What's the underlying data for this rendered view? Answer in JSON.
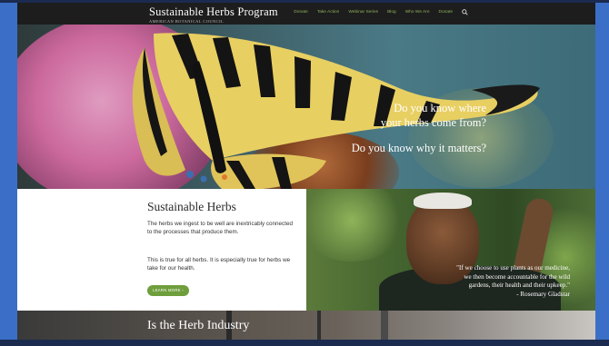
{
  "header": {
    "title": "Sustainable Herbs Program",
    "subtitle": "AMERICAN BOTANICAL COUNCIL",
    "nav": [
      "Donate",
      "Take Action",
      "Webinar Series",
      "Blog",
      "Who We Are",
      "Donate"
    ],
    "search_icon": "search-icon"
  },
  "hero": {
    "line1": "Do you know where",
    "line2": "your herbs come from?",
    "line3": "Do you know why it matters?"
  },
  "intro": {
    "title": "Sustainable Herbs",
    "paragraph1": "The herbs we ingest to be well are inextricably connected to the processes that produce them.",
    "paragraph2": "This is true for all herbs. It is especially true for herbs we take for our health.",
    "button": "LEARN MORE ›"
  },
  "quote": {
    "line1": "\"If we choose to use plants as our medicine,",
    "line2": "we then become accountable for the wild",
    "line3": "gardens, their health and their upkeep.\"",
    "attribution": "- Rosemary Gladstar"
  },
  "bottom": {
    "title": "Is the Herb Industry"
  },
  "colors": {
    "accent": "#6f9e3c",
    "nav_link": "#8fb05a",
    "header_bg": "#1d1d1d",
    "frame": "#3b6fc7"
  }
}
